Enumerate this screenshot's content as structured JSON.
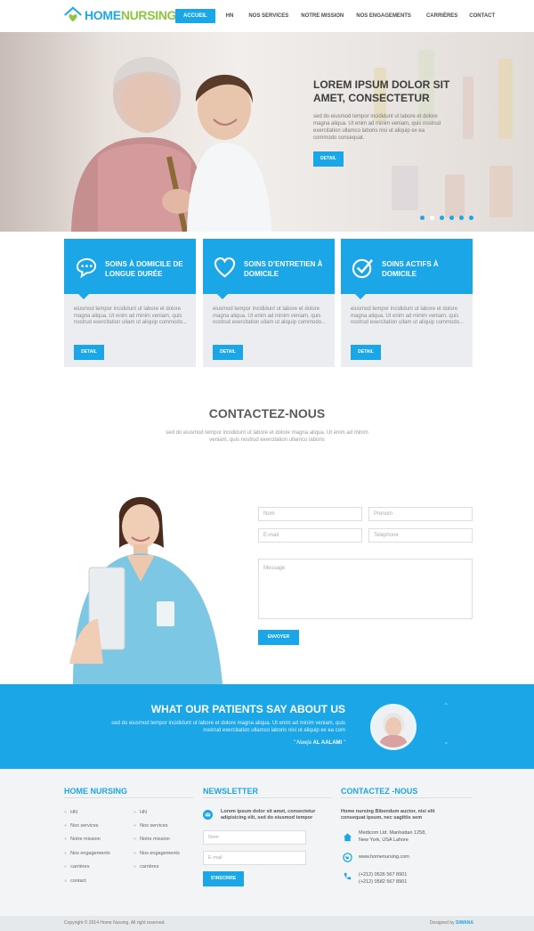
{
  "brand": {
    "home": "HOME",
    "nursing": "NURSING"
  },
  "nav": [
    "ACCUEIL",
    "HN",
    "NOS SERVICES",
    "NOTRE MISSION",
    "NOS ENGAGEMENTS",
    "CARRIÈRES",
    "CONTACT"
  ],
  "hero": {
    "title": "LOREM IPSUM DOLOR SIT AMET, CONSECTETUR",
    "text": "sed do eiusmod tempor incididunt ut labore et dolore magna aliqua. Ut enim ad minim veniam, quis nostrud exercitation ullamco laboris nisi ut aliquip ex ea commodo consequat.",
    "button": "DETAIL",
    "slides": 6,
    "active_slide": 2
  },
  "services": [
    {
      "title": "SOINS À DOMICILE DE LONGUE DURÉE",
      "icon": "chat-bubbles-icon",
      "text": "eiusmod tempor incididunt ut labore et dolore magna aliqua. Ut enim ad minim veniam, quis nostrud exercitation ullam ut aliquip commodo...",
      "button": "DETAIL"
    },
    {
      "title": "SOINS D’ENTRETIEN À DOMICILE",
      "icon": "heart-icon",
      "text": "eiusmod tempor incididunt ut labore et dolore magna aliqua. Ut enim ad minim veniam, quis nostrud exercitation ullam ut aliquip commodo...",
      "button": "DETAIL"
    },
    {
      "title": "SOINS ACTIFS À DOMICILE",
      "icon": "check-circle-icon",
      "text": "eiusmod tempor incididunt ut labore et dolore magna aliqua. Ut enim ad minim veniam, quis nostrud exercitation ullam ut aliquip commodo...",
      "button": "DETAIL"
    }
  ],
  "contact": {
    "title": "CONTACTEZ-NOUS",
    "subtitle": "sed do eiusmod tempor incididunt ut labore et dolore magna aliqua. Ut enim ad minim veniam, quis nostrud exercitation ullamco laboris",
    "name_placeholder": "Nom",
    "firstname_placeholder": "Prenom",
    "email_placeholder": "E-mail",
    "phone_placeholder": "Telephone",
    "message_placeholder": "Message",
    "button": "ENVOYER"
  },
  "testimonial": {
    "title": "WHAT OUR PATIENTS SAY ABOUT US",
    "text": "sed do eiusmod tempor incididunt ut labore et dolore magna aliqua. Ut enim ad minim veniam, quis nostrud exercitation ullamco laboris nisi ut aliquip ex ea com",
    "quote_prefix": "\" Nawja ",
    "author": "AL AALAMI",
    "quote_suffix": " \""
  },
  "footer": {
    "col1_title": "HOME NURSING",
    "links_left": [
      "HN",
      "Nos services",
      "Notre mission",
      "Nos engagements",
      "carrières",
      "contact"
    ],
    "links_right": [
      "HN",
      "Nos services",
      "Notre mission",
      "Nos engagements",
      "carrières"
    ],
    "newsletter_title": "NEWSLETTER",
    "newsletter_text": "Lorem ipsum dolor sit amet, consectetur adipisicing elit, sed do eiusmod tempor",
    "newsletter_name_placeholder": "Nom",
    "newsletter_email_placeholder": "E-mail",
    "newsletter_button": "S'INSCRIRE",
    "contact_title": "CONTACTEZ -NOUS",
    "contact_intro": "Home nursing Bibendum auctor, nisi elit consequat ipsum, nec sagittis sem",
    "address_line1": "Medicom Ltd. Manhattan 1258,",
    "address_line2": "New York, USA Lahore",
    "website": "www.homenursing.com",
    "phone1": "(+212) 0526 567 8901",
    "phone2": "(+212) 0582 567 8901"
  },
  "copyright": "Copyright © 2014 Home Nursing. All right reserved.",
  "credit_prefix": "Designed by ",
  "credit_name": "SIWANA",
  "colors": {
    "accent": "#1ba6e8",
    "brand_green": "#8cc63f"
  }
}
